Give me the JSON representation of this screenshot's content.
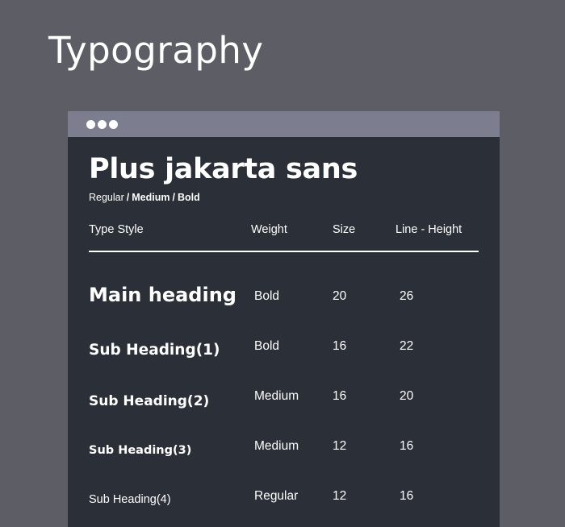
{
  "page": {
    "title": "Typography"
  },
  "card": {
    "font_name": "Plus jakarta sans",
    "weights": [
      "Regular",
      "Medium",
      "Bold"
    ],
    "separator": "/",
    "columns": [
      "Type Style",
      "Weight",
      "Size",
      "Line - Height"
    ],
    "rows": [
      {
        "style": "Main heading",
        "weight": "Bold",
        "size": "20",
        "line_height": "26"
      },
      {
        "style": "Sub Heading(1)",
        "weight": "Bold",
        "size": "16",
        "line_height": "22"
      },
      {
        "style": "Sub Heading(2)",
        "weight": "Medium",
        "size": "16",
        "line_height": "20"
      },
      {
        "style": "Sub Heading(3)",
        "weight": "Medium",
        "size": "12",
        "line_height": "16"
      },
      {
        "style": "Sub Heading(4)",
        "weight": "Regular",
        "size": "12",
        "line_height": "16"
      }
    ]
  },
  "colors": {
    "background": "#5d5d66",
    "card": "#2a2f38",
    "titlebar": "#7c7e90",
    "text": "#ffffff"
  }
}
